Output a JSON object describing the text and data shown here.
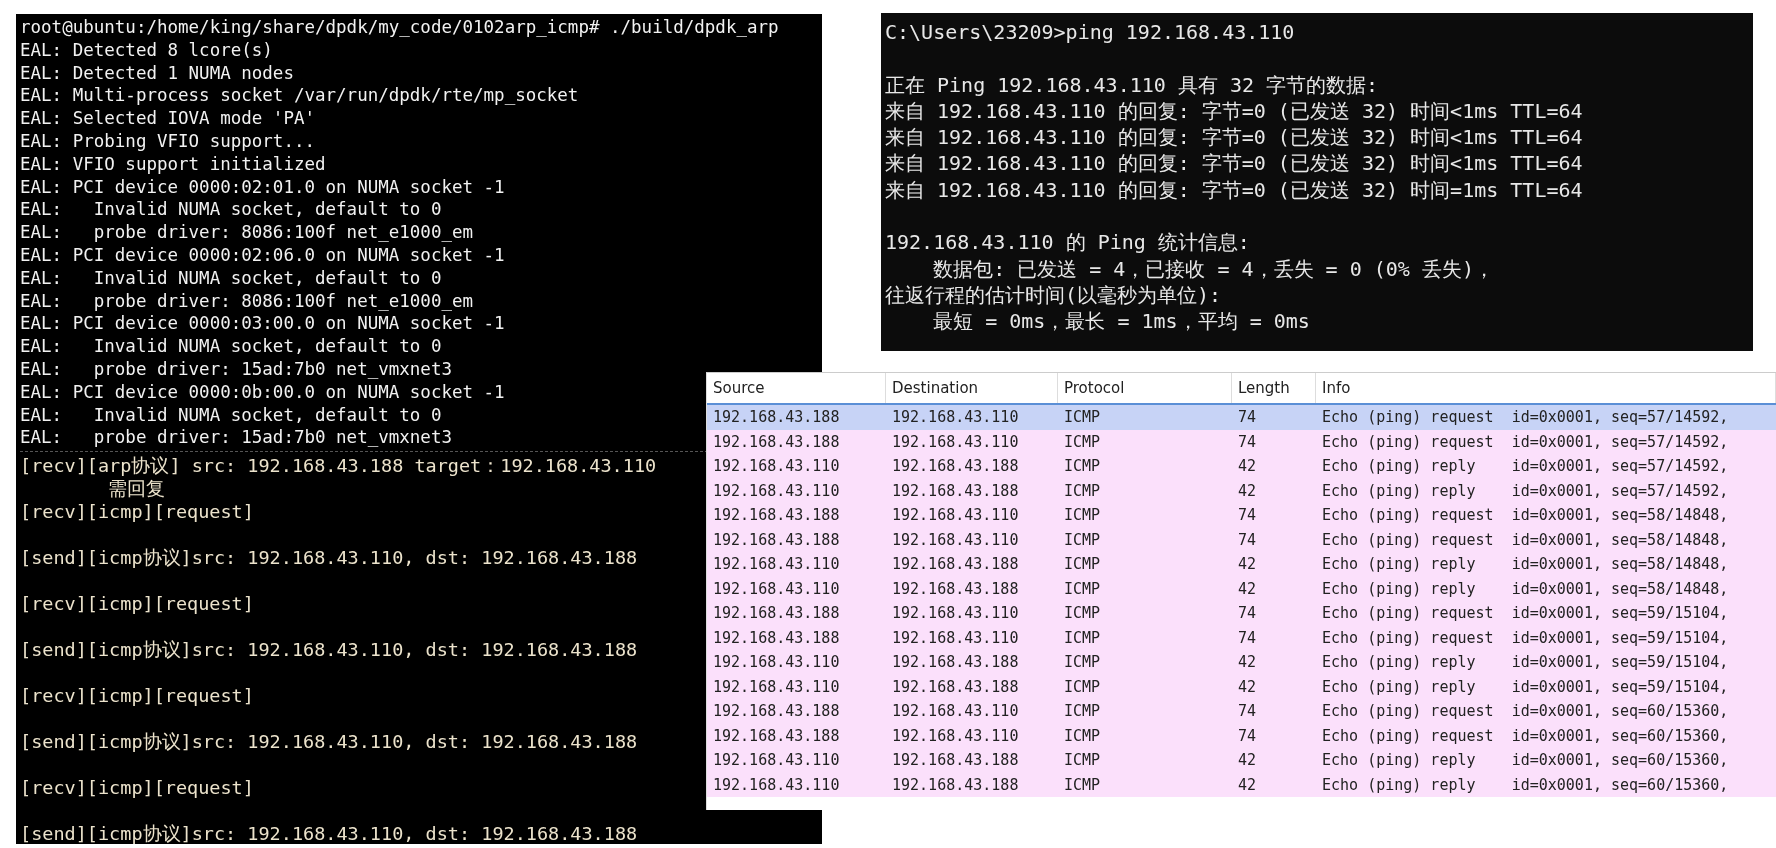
{
  "dpdk_terminal": {
    "log_lines": [
      "root@ubuntu:/home/king/share/dpdk/my_code/0102arp_icmp# ./build/dpdk_arp",
      "EAL: Detected 8 lcore(s)",
      "EAL: Detected 1 NUMA nodes",
      "EAL: Multi-process socket /var/run/dpdk/rte/mp_socket",
      "EAL: Selected IOVA mode 'PA'",
      "EAL: Probing VFIO support...",
      "EAL: VFIO support initialized",
      "EAL: PCI device 0000:02:01.0 on NUMA socket -1",
      "EAL:   Invalid NUMA socket, default to 0",
      "EAL:   probe driver: 8086:100f net_e1000_em",
      "EAL: PCI device 0000:02:06.0 on NUMA socket -1",
      "EAL:   Invalid NUMA socket, default to 0",
      "EAL:   probe driver: 8086:100f net_e1000_em",
      "EAL: PCI device 0000:03:00.0 on NUMA socket -1",
      "EAL:   Invalid NUMA socket, default to 0",
      "EAL:   probe driver: 15ad:7b0 net_vmxnet3",
      "EAL: PCI device 0000:0b:00.0 on NUMA socket -1",
      "EAL:   Invalid NUMA socket, default to 0",
      "EAL:   probe driver: 15ad:7b0 net_vmxnet3"
    ],
    "output_lines": [
      {
        "text": "[recv][arp协议] src: 192.168.43.188 target：192.168.43.110",
        "kind": "line"
      },
      {
        "text": "需回复",
        "kind": "continuation"
      },
      {
        "text": "[recv][icmp][request]",
        "kind": "line"
      },
      {
        "kind": "blank"
      },
      {
        "text": "[send][icmp协议]src: 192.168.43.110, dst: 192.168.43.188",
        "kind": "line"
      },
      {
        "kind": "blank"
      },
      {
        "text": "[recv][icmp][request]",
        "kind": "line"
      },
      {
        "kind": "blank"
      },
      {
        "text": "[send][icmp协议]src: 192.168.43.110, dst: 192.168.43.188",
        "kind": "line"
      },
      {
        "kind": "blank"
      },
      {
        "text": "[recv][icmp][request]",
        "kind": "line"
      },
      {
        "kind": "blank"
      },
      {
        "text": "[send][icmp协议]src: 192.168.43.110, dst: 192.168.43.188",
        "kind": "line"
      },
      {
        "kind": "blank"
      },
      {
        "text": "[recv][icmp][request]",
        "kind": "line"
      },
      {
        "kind": "blank"
      },
      {
        "text": "[send][icmp协议]src: 192.168.43.110, dst: 192.168.43.188",
        "kind": "line"
      }
    ]
  },
  "cmd_window": {
    "lines": [
      {
        "kind": "line",
        "text": "C:\\Users\\23209>ping 192.168.43.110"
      },
      {
        "kind": "blank"
      },
      {
        "kind": "line",
        "text": "正在 Ping 192.168.43.110 具有 32 字节的数据:"
      },
      {
        "kind": "line",
        "text": "来自 192.168.43.110 的回复: 字节=0 (已发送 32) 时间<1ms TTL=64"
      },
      {
        "kind": "line",
        "text": "来自 192.168.43.110 的回复: 字节=0 (已发送 32) 时间<1ms TTL=64"
      },
      {
        "kind": "line",
        "text": "来自 192.168.43.110 的回复: 字节=0 (已发送 32) 时间<1ms TTL=64"
      },
      {
        "kind": "line",
        "text": "来自 192.168.43.110 的回复: 字节=0 (已发送 32) 时间=1ms TTL=64"
      },
      {
        "kind": "blank"
      },
      {
        "kind": "line",
        "text": "192.168.43.110 的 Ping 统计信息:"
      },
      {
        "kind": "line",
        "text": "    数据包: 已发送 = 4，已接收 = 4，丢失 = 0 (0% 丢失)，"
      },
      {
        "kind": "line",
        "text": "往返行程的估计时间(以毫秒为单位):"
      },
      {
        "kind": "line",
        "text": "    最短 = 0ms，最长 = 1ms，平均 = 0ms"
      }
    ]
  },
  "packet_list": {
    "columns": [
      "Source",
      "Destination",
      "Protocol",
      "Length",
      "Info"
    ],
    "rows": [
      {
        "selected": true,
        "cells": [
          "192.168.43.188",
          "192.168.43.110",
          "ICMP",
          "74",
          "Echo (ping) request  id=0x0001, seq=57/14592,"
        ]
      },
      {
        "selected": false,
        "cells": [
          "192.168.43.188",
          "192.168.43.110",
          "ICMP",
          "74",
          "Echo (ping) request  id=0x0001, seq=57/14592,"
        ]
      },
      {
        "selected": false,
        "cells": [
          "192.168.43.110",
          "192.168.43.188",
          "ICMP",
          "42",
          "Echo (ping) reply    id=0x0001, seq=57/14592,"
        ]
      },
      {
        "selected": false,
        "cells": [
          "192.168.43.110",
          "192.168.43.188",
          "ICMP",
          "42",
          "Echo (ping) reply    id=0x0001, seq=57/14592,"
        ]
      },
      {
        "selected": false,
        "cells": [
          "192.168.43.188",
          "192.168.43.110",
          "ICMP",
          "74",
          "Echo (ping) request  id=0x0001, seq=58/14848,"
        ]
      },
      {
        "selected": false,
        "cells": [
          "192.168.43.188",
          "192.168.43.110",
          "ICMP",
          "74",
          "Echo (ping) request  id=0x0001, seq=58/14848,"
        ]
      },
      {
        "selected": false,
        "cells": [
          "192.168.43.110",
          "192.168.43.188",
          "ICMP",
          "42",
          "Echo (ping) reply    id=0x0001, seq=58/14848,"
        ]
      },
      {
        "selected": false,
        "cells": [
          "192.168.43.110",
          "192.168.43.188",
          "ICMP",
          "42",
          "Echo (ping) reply    id=0x0001, seq=58/14848,"
        ]
      },
      {
        "selected": false,
        "cells": [
          "192.168.43.188",
          "192.168.43.110",
          "ICMP",
          "74",
          "Echo (ping) request  id=0x0001, seq=59/15104,"
        ]
      },
      {
        "selected": false,
        "cells": [
          "192.168.43.188",
          "192.168.43.110",
          "ICMP",
          "74",
          "Echo (ping) request  id=0x0001, seq=59/15104,"
        ]
      },
      {
        "selected": false,
        "cells": [
          "192.168.43.110",
          "192.168.43.188",
          "ICMP",
          "42",
          "Echo (ping) reply    id=0x0001, seq=59/15104,"
        ]
      },
      {
        "selected": false,
        "cells": [
          "192.168.43.110",
          "192.168.43.188",
          "ICMP",
          "42",
          "Echo (ping) reply    id=0x0001, seq=59/15104,"
        ]
      },
      {
        "selected": false,
        "cells": [
          "192.168.43.188",
          "192.168.43.110",
          "ICMP",
          "74",
          "Echo (ping) request  id=0x0001, seq=60/15360,"
        ]
      },
      {
        "selected": false,
        "cells": [
          "192.168.43.188",
          "192.168.43.110",
          "ICMP",
          "74",
          "Echo (ping) request  id=0x0001, seq=60/15360,"
        ]
      },
      {
        "selected": false,
        "cells": [
          "192.168.43.110",
          "192.168.43.188",
          "ICMP",
          "42",
          "Echo (ping) reply    id=0x0001, seq=60/15360,"
        ]
      },
      {
        "selected": false,
        "cells": [
          "192.168.43.110",
          "192.168.43.188",
          "ICMP",
          "42",
          "Echo (ping) reply    id=0x0001, seq=60/15360,"
        ]
      }
    ]
  }
}
